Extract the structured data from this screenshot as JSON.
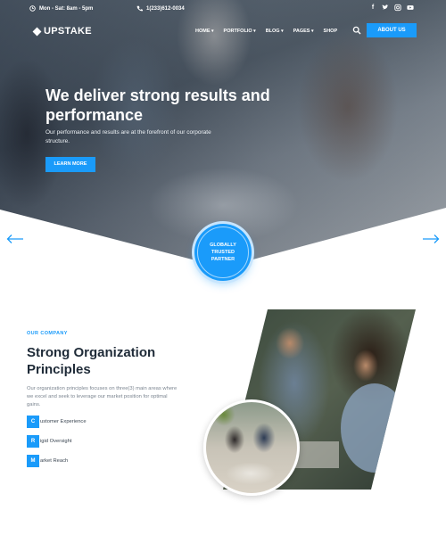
{
  "topbar": {
    "hours": "Mon - Sat: 8am - 5pm",
    "phone": "1(233)612-0034",
    "social": [
      "f",
      "t",
      "ig",
      "yt"
    ]
  },
  "brand": {
    "name": "UPSTAKE"
  },
  "nav": {
    "items": [
      {
        "label": "HOME",
        "caret": "▾"
      },
      {
        "label": "PORTFOLIO",
        "caret": "▾"
      },
      {
        "label": "BLOG",
        "caret": "▾"
      },
      {
        "label": "PAGES",
        "caret": "▾"
      },
      {
        "label": "SHOP",
        "caret": ""
      }
    ],
    "cta": "ABOUT US"
  },
  "hero": {
    "title": "We deliver strong results and performance",
    "subtitle": "Our performance and results are at the forefront of our corporate structure.",
    "button": "LEARN MORE"
  },
  "badge": {
    "lines": [
      "GLOBALLY",
      "TRUSTED",
      "PARTNER"
    ]
  },
  "company": {
    "eyebrow": "OUR COMPANY",
    "title": "Strong Organization Principles",
    "body": "Our organization principles focuses on three(3) main areas where we excel and seek to leverage our market position for optimal gains.",
    "features": [
      {
        "initial": "C",
        "rest": "ustomer Experience"
      },
      {
        "initial": "R",
        "rest": "igid Oversight"
      },
      {
        "initial": "M",
        "rest": "arket Reach"
      }
    ]
  },
  "colors": {
    "accent": "#1a9bfa",
    "heading": "#1f2b38",
    "body": "#7b8590"
  },
  "icons": {
    "clock": "clock-icon",
    "phone": "phone-icon",
    "search": "search-icon",
    "prev": "arrow-left-icon",
    "next": "arrow-right-icon"
  }
}
